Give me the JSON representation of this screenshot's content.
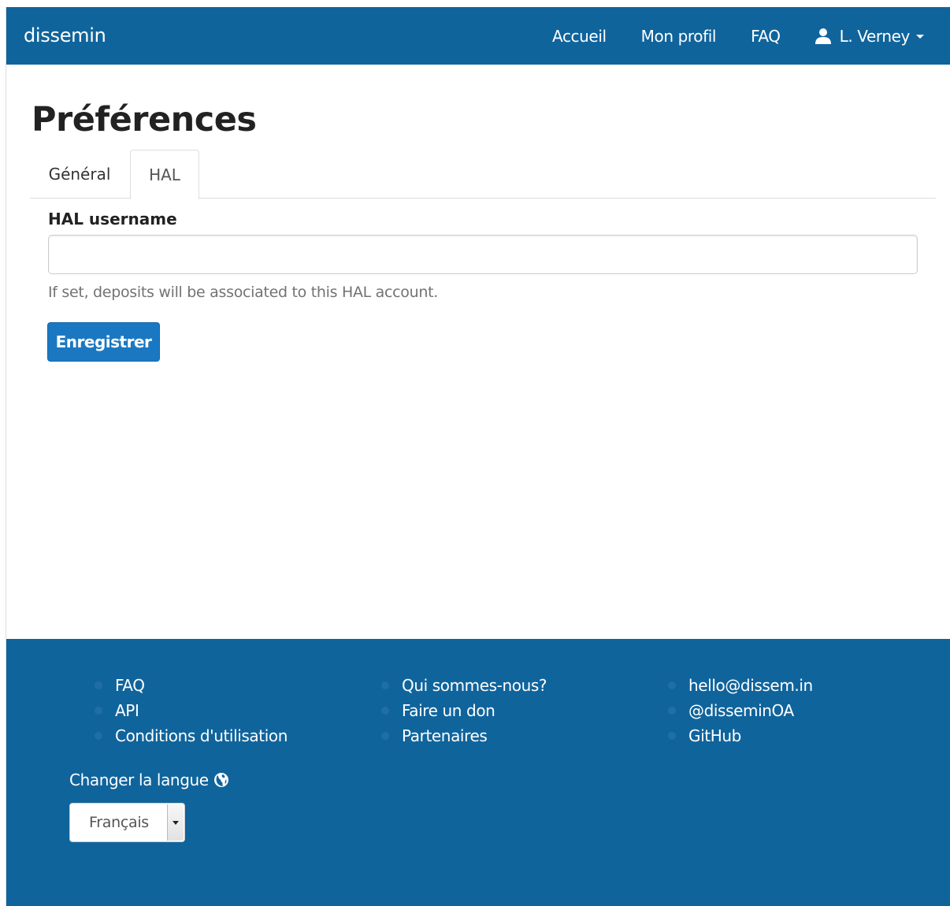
{
  "navbar": {
    "brand": "dissemin",
    "links": {
      "home": "Accueil",
      "profile": "Mon profil",
      "faq": "FAQ",
      "user": "L. Verney"
    },
    "icons": {
      "user": "user-icon",
      "caret": "caret-down-icon"
    },
    "background": "#10649c"
  },
  "page": {
    "title": "Préférences",
    "tabs": [
      {
        "label": "Général",
        "active": false
      },
      {
        "label": "HAL",
        "active": true
      }
    ],
    "form": {
      "field_label": "HAL username",
      "field_value": "",
      "field_placeholder": "",
      "help_text": "If set, deposits will be associated to this HAL account.",
      "submit_label": "Enregistrer"
    }
  },
  "footer": {
    "columns": [
      [
        "FAQ",
        "API",
        "Conditions d'utilisation"
      ],
      [
        "Qui sommes-nous?",
        "Faire un don",
        "Partenaires"
      ],
      [
        "hello@dissem.in",
        "@disseminOA",
        "GitHub"
      ]
    ],
    "language_label": "Changer la langue",
    "language_icon": "globe-icon",
    "language_selected": "Français",
    "background": "#10649c"
  }
}
